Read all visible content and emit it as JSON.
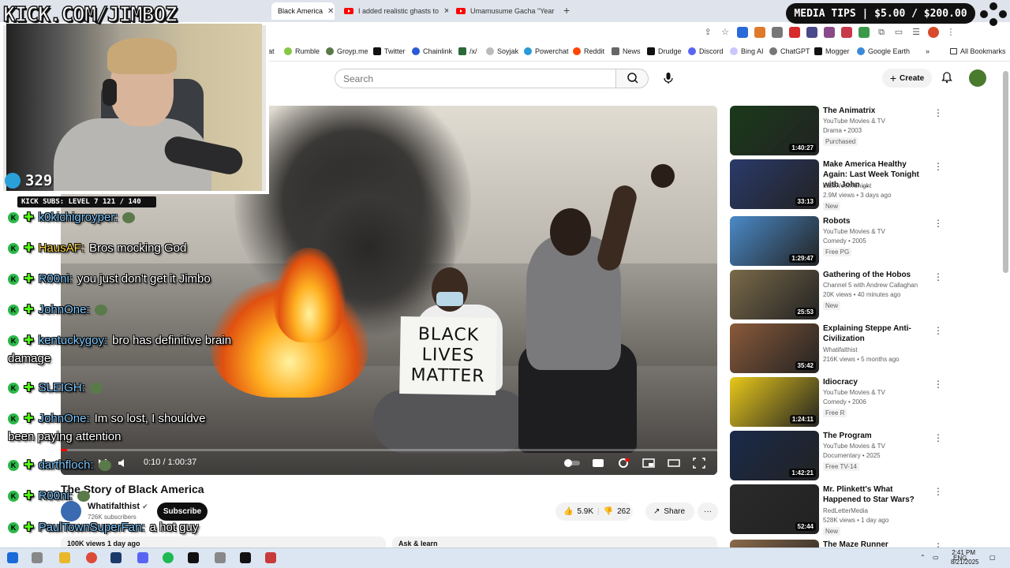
{
  "browser": {
    "tabs": [
      {
        "label": "Black America"
      },
      {
        "label": "I added realistic ghasts to"
      },
      {
        "label": "Umamusume Gacha \"Year"
      }
    ],
    "new_tab": "+",
    "bookmarks": [
      "at",
      "Rumble",
      "Groyp.me",
      "Twitter",
      "Chainlink",
      "/x/",
      "Soyjak",
      "Powerchat",
      "Reddit",
      "News",
      "Drudge",
      "Discord",
      "Bing AI",
      "ChatGPT",
      "Mogger",
      "Google Earth"
    ],
    "bookmarks_more": "»",
    "all_bookmarks": "All Bookmarks"
  },
  "youtube": {
    "search_placeholder": "Search",
    "create_label": "Create",
    "video": {
      "current_time": "0:10",
      "total_time": "1:00:37",
      "progress_fraction": 0.003,
      "title": "The Story of Black America",
      "sign_lines": [
        "BLACK",
        "LIVES",
        "MATTER"
      ]
    },
    "channel": {
      "name": "Whatifalthist",
      "subscribers": "726K subscribers",
      "subscribe_label": "Subscribe"
    },
    "actions": {
      "likes": "5.9K",
      "dislikes": "262",
      "share": "Share",
      "more": "···"
    },
    "description_teaser": "100K views  1 day ago",
    "ask_label": "Ask & learn",
    "recommendations": [
      {
        "title": "The Animatrix",
        "channel": "YouTube Movies & TV",
        "meta": "Drama • 2003",
        "badge": "Purchased",
        "duration": "1:40:27",
        "thumb_color": "#1a3a1a"
      },
      {
        "title": "Make America Healthy Again: Last Week Tonight with John ...",
        "channel": "LastWeekTonight",
        "meta": "2.9M views • 3 days ago",
        "badge": "New",
        "duration": "33:13",
        "thumb_color": "#2a3a6a"
      },
      {
        "title": "Robots",
        "channel": "YouTube Movies & TV",
        "meta": "Comedy • 2005",
        "badge": "Free  PG",
        "duration": "1:29:47",
        "thumb_color": "#4a8ac8"
      },
      {
        "title": "Gathering of the Hobos",
        "channel": "Channel 5 with Andrew Callaghan",
        "meta": "20K views • 40 minutes ago",
        "badge": "New",
        "duration": "25:53",
        "thumb_color": "#7a6a4a"
      },
      {
        "title": "Explaining Steppe Anti-Civilization",
        "channel": "Whatifalthist",
        "meta": "216K views • 5 months ago",
        "badge": "",
        "duration": "35:42",
        "thumb_color": "#8a5a3a"
      },
      {
        "title": "Idiocracy",
        "channel": "YouTube Movies & TV",
        "meta": "Comedy • 2006",
        "badge": "Free  R",
        "duration": "1:24:11",
        "thumb_color": "#e8c81a"
      },
      {
        "title": "The Program",
        "channel": "YouTube Movies & TV",
        "meta": "Documentary • 2025",
        "badge": "Free  TV-14",
        "duration": "1:42:21",
        "thumb_color": "#1a2a4a"
      },
      {
        "title": "Mr. Plinkett's What Happened to Star Wars?",
        "channel": "RedLetterMedia",
        "meta": "528K views • 1 day ago",
        "badge": "New",
        "duration": "52:44",
        "thumb_color": "#2a2a2a"
      },
      {
        "title": "The Maze Runner",
        "channel": "",
        "meta": "",
        "badge": "",
        "duration": "",
        "thumb_color": "#8a6a4a"
      }
    ]
  },
  "overlay": {
    "kick_url": "KICK.COM/JIMBOZ",
    "media_tips": "MEDIA TIPS | $5.00 / $200.00",
    "viewer_count": "329",
    "kick_subs": "KICK SUBS: LEVEL 7 121 / 140",
    "chat": [
      {
        "user": "k0kichigroyper:",
        "message": "",
        "gold": false
      },
      {
        "user": "HausAF:",
        "message": "Bros mocking God",
        "gold": true
      },
      {
        "user": "R00ni:",
        "message": "you just don't get it Jimbo",
        "gold": false
      },
      {
        "user": "JohnOne:",
        "message": "",
        "gold": false
      },
      {
        "user": "kentuckygoy:",
        "message": "bro has definitive brain",
        "gold": false
      },
      {
        "user": "",
        "message": "damage",
        "gold": false
      },
      {
        "user": "SLEIGH:",
        "message": "",
        "gold": false
      },
      {
        "user": "JohnOne:",
        "message": "Im so lost, I shouldve",
        "gold": false
      },
      {
        "user": "",
        "message": "been paying attention",
        "gold": false
      },
      {
        "user": "darthfloch:",
        "message": "",
        "gold": false
      },
      {
        "user": "R00ni:",
        "message": "",
        "gold": false
      },
      {
        "user": "PaulTownSuperFan:",
        "message": "a hot guy",
        "gold": false
      }
    ]
  },
  "taskbar": {
    "lang": "ENG",
    "time": "2:41 PM",
    "date": "8/21/2025"
  }
}
